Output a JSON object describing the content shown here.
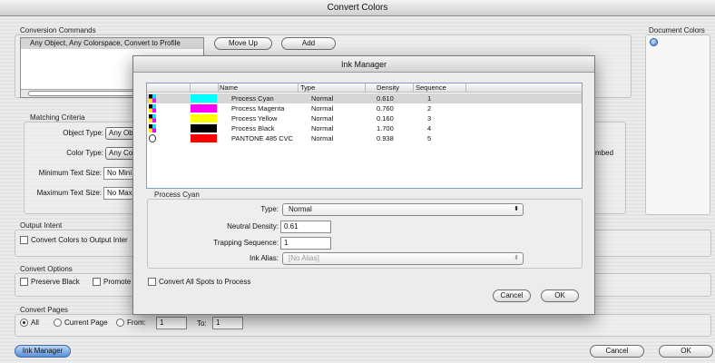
{
  "window": {
    "title": "Convert Colors"
  },
  "conversion": {
    "label": "Conversion Commands",
    "command": "Any Object, Any Colorspace, Convert to Profile",
    "move_up": "Move Up",
    "add": "Add"
  },
  "document_colors": {
    "label": "Document Colors"
  },
  "matching": {
    "label": "Matching Criteria",
    "object_type_label": "Object Type:",
    "object_type_value": "Any Ob",
    "color_type_label": "Color Type:",
    "color_type_value": "Any Co",
    "min_text_label": "Minimum Text Size:",
    "min_text_value": "No Mini",
    "max_text_label": "Maximum Text Size:",
    "max_text_value": "No Maxi",
    "embed_partial": "mbed"
  },
  "output_intent": {
    "label": "Output Intent",
    "checkbox": "Convert Colors to Output Inter"
  },
  "convert_options": {
    "label": "Convert Options",
    "preserve_black": "Preserve Black",
    "promote": "Promote"
  },
  "convert_pages": {
    "label": "Convert Pages",
    "all": "All",
    "current_page": "Current Page",
    "from_label": "From:",
    "from_value": "1",
    "to_label": "To:",
    "to_value": "1"
  },
  "footer": {
    "ink_manager": "Ink Manager",
    "cancel": "Cancel",
    "ok": "OK"
  },
  "ink_manager": {
    "title": "Ink Manager",
    "columns": [
      "Name",
      "Type",
      "Density",
      "Sequence"
    ],
    "inks": [
      {
        "name": "Process Cyan",
        "type": "Normal",
        "density": "0.610",
        "sequence": "1",
        "color": "#00ffff",
        "icon": "process-ink-icon"
      },
      {
        "name": "Process Magenta",
        "type": "Normal",
        "density": "0.760",
        "sequence": "2",
        "color": "#ff00ff",
        "icon": "process-ink-icon"
      },
      {
        "name": "Process Yellow",
        "type": "Normal",
        "density": "0.160",
        "sequence": "3",
        "color": "#ffff00",
        "icon": "process-ink-icon"
      },
      {
        "name": "Process Black",
        "type": "Normal",
        "density": "1.700",
        "sequence": "4",
        "color": "#000000",
        "icon": "process-ink-icon"
      },
      {
        "name": "PANTONE 485 CVC",
        "type": "Normal",
        "density": "0.938",
        "sequence": "5",
        "color": "#ff0000",
        "icon": "spot-ink-icon"
      }
    ],
    "selected_row": 0,
    "detail": {
      "group_label": "Process Cyan",
      "type_label": "Type:",
      "type_value": "Normal",
      "density_label": "Neutral Density:",
      "density_value": "0.61",
      "trapping_label": "Trapping Sequence:",
      "trapping_value": "1",
      "alias_label": "Ink Alias:",
      "alias_value": "[No Alias]"
    },
    "convert_spots": "Convert All Spots to Process",
    "cancel": "Cancel",
    "ok": "OK"
  }
}
